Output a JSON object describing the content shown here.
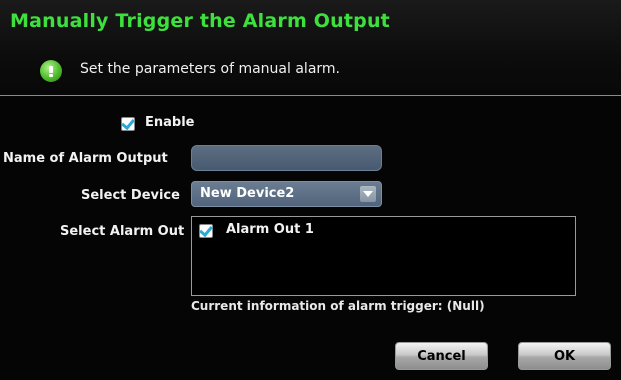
{
  "dialog": {
    "title": "Manually Trigger the Alarm Output",
    "subtitle": "Set the parameters of manual alarm."
  },
  "form": {
    "enable": {
      "label": "Enable",
      "checked": true
    },
    "name_label": "Name of Alarm Output",
    "name_value": "",
    "device_label": "Select Device",
    "device_value": "New Device2",
    "alarm_out_label": "Select Alarm Out",
    "alarm_out_items": [
      {
        "label": "Alarm Out 1",
        "checked": true
      }
    ],
    "status_text": "Current information of alarm trigger: (Null)"
  },
  "buttons": {
    "cancel": "Cancel",
    "ok": "OK"
  },
  "colors": {
    "title": "#3ee03e",
    "check": "#2aa8d8"
  }
}
